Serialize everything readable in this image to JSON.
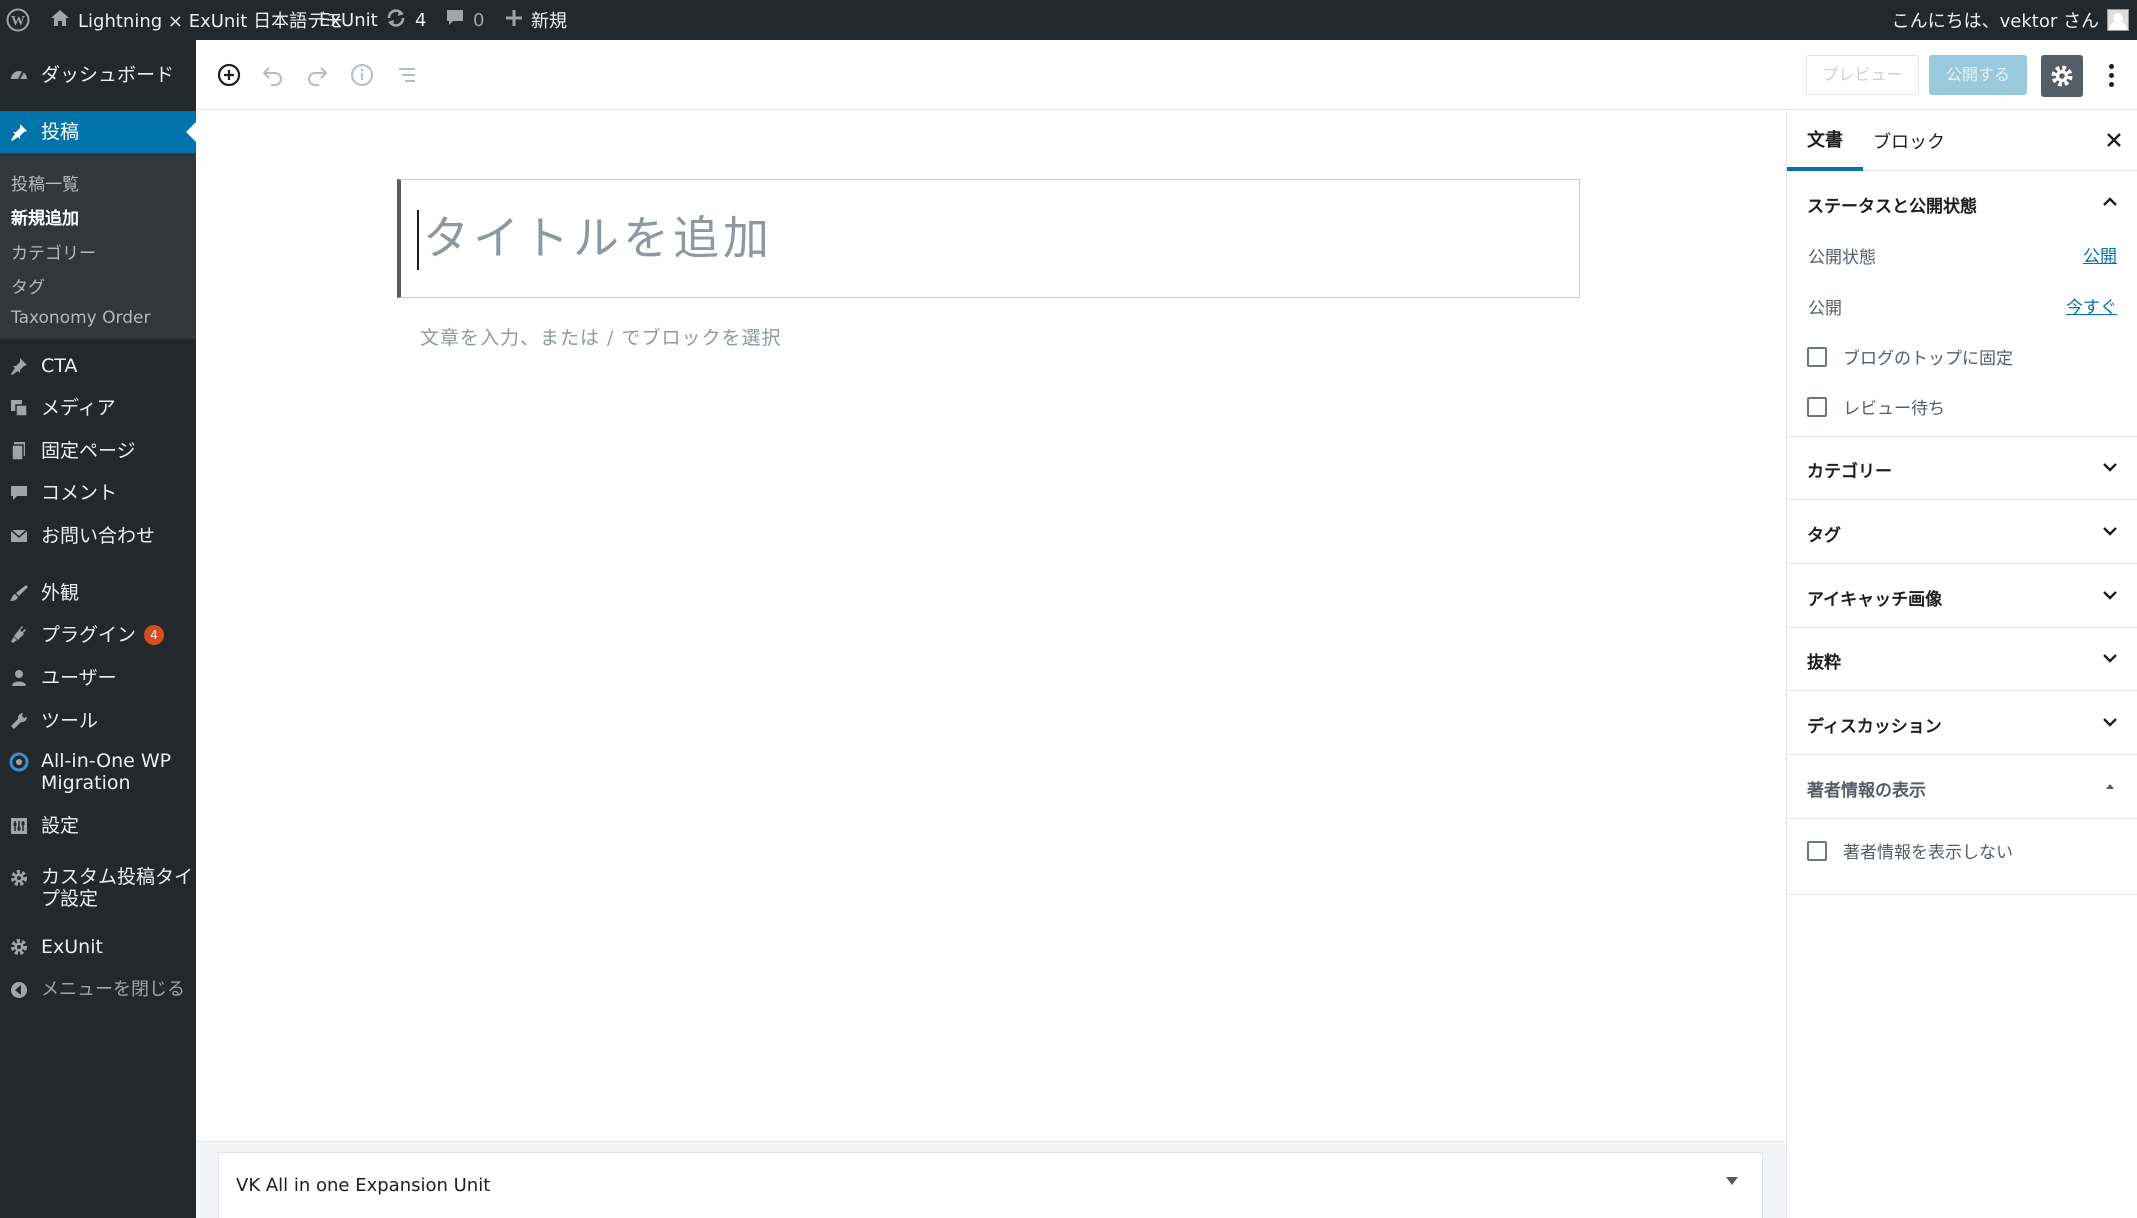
{
  "adminbar": {
    "site_name": "Lightning × ExUnit 日本語デモ",
    "exunit": "ExUnit",
    "updates_count": "4",
    "comments_count": "0",
    "new_label": "新規",
    "greeting": "こんにちは、vektor さん"
  },
  "sidebar": {
    "dashboard": "ダッシュボード",
    "posts": "投稿",
    "posts_sub": [
      "投稿一覧",
      "新規追加",
      "カテゴリー",
      "タグ",
      "Taxonomy Order"
    ],
    "cta": "CTA",
    "media": "メディア",
    "pages": "固定ページ",
    "comments": "コメント",
    "contact": "お問い合わせ",
    "appearance": "外観",
    "plugins": "プラグイン",
    "plugins_badge": "4",
    "users": "ユーザー",
    "tools": "ツール",
    "aio_line1": "All-in-One WP",
    "aio_line2": "Migration",
    "settings": "設定",
    "cpt_line1": "カスタム投稿タイ",
    "cpt_line2": "プ設定",
    "exunit": "ExUnit",
    "collapse": "メニューを閉じる"
  },
  "toolbar": {
    "preview_label": "プレビュー",
    "publish_label": "公開する"
  },
  "editor": {
    "title_placeholder": "タイトルを追加",
    "body_placeholder": "文章を入力、または / でブロックを選択",
    "metabox_title": "VK All in one Expansion Unit"
  },
  "settings_panel": {
    "tab_document": "文書",
    "tab_block": "ブロック",
    "status_title": "ステータスと公開状態",
    "visibility_label": "公開状態",
    "visibility_value": "公開",
    "publish_label": "公開",
    "publish_value": "今すぐ",
    "stick_label": "ブログのトップに固定",
    "pending_label": "レビュー待ち",
    "categories_title": "カテゴリー",
    "tags_title": "タグ",
    "featured_title": "アイキャッチ画像",
    "excerpt_title": "抜粋",
    "discussion_title": "ディスカッション",
    "author_title": "著者情報の表示",
    "author_hide_label": "著者情報を表示しない"
  }
}
